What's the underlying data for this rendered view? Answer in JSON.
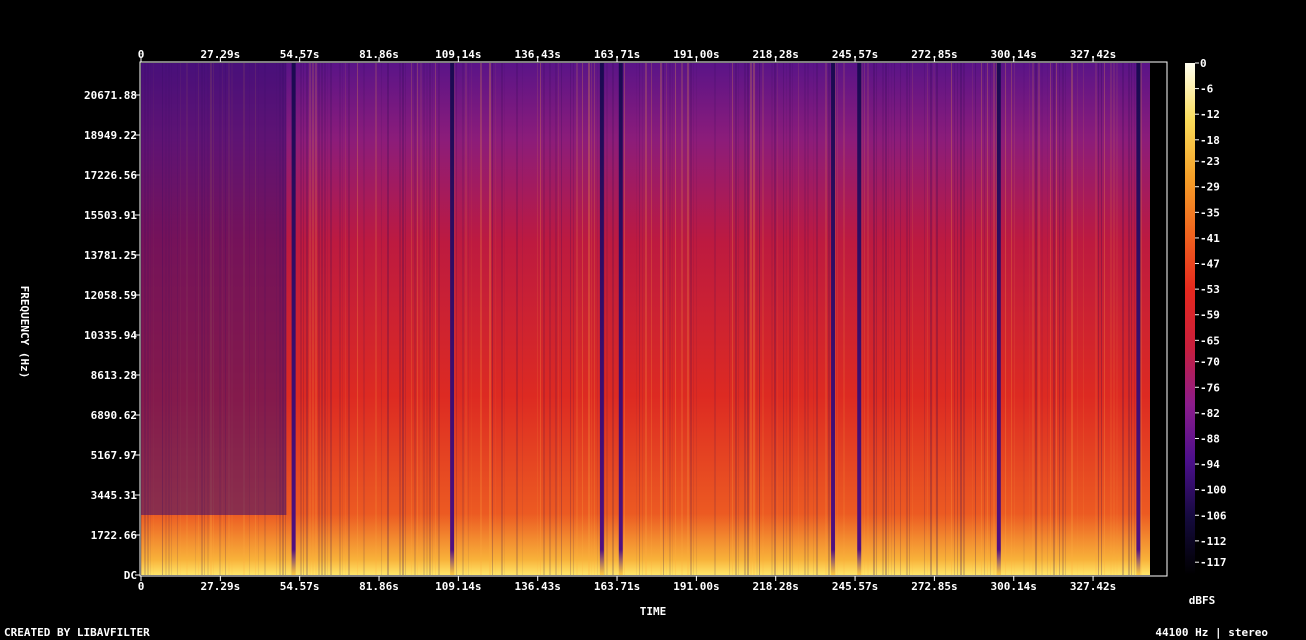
{
  "chart_data": {
    "type": "heatmap",
    "subtype": "spectrogram",
    "xlabel": "TIME",
    "ylabel": "FREQUENCY (Hz)",
    "colorbar_label": "dBFS",
    "x_ticks": [
      "0",
      "27.29s",
      "54.57s",
      "81.86s",
      "109.14s",
      "136.43s",
      "163.71s",
      "191.00s",
      "218.28s",
      "245.57s",
      "272.85s",
      "300.14s",
      "327.42s"
    ],
    "x_tick_values": [
      0,
      27.29,
      54.57,
      81.86,
      109.14,
      136.43,
      163.71,
      191.0,
      218.28,
      245.57,
      272.85,
      300.14,
      327.42
    ],
    "xlim": [
      0,
      347
    ],
    "y_ticks": [
      "DC",
      "1722.66",
      "3445.31",
      "5167.97",
      "6890.62",
      "8613.28",
      "10335.94",
      "12058.59",
      "13781.25",
      "15503.91",
      "17226.56",
      "18949.22",
      "20671.88"
    ],
    "y_tick_values": [
      0,
      1722.66,
      3445.31,
      5167.97,
      6890.62,
      8613.28,
      10335.94,
      12058.59,
      13781.25,
      15503.91,
      17226.56,
      18949.22,
      20671.88
    ],
    "ylim": [
      0,
      22050
    ],
    "colorbar_ticks": [
      "0",
      "-6",
      "-12",
      "-18",
      "-23",
      "-29",
      "-35",
      "-41",
      "-47",
      "-53",
      "-59",
      "-65",
      "-70",
      "-76",
      "-82",
      "-88",
      "-94",
      "-100",
      "-106",
      "-112",
      "-117"
    ],
    "colorbar_values": [
      0,
      -6,
      -12,
      -18,
      -23,
      -29,
      -35,
      -41,
      -47,
      -53,
      -59,
      -65,
      -70,
      -76,
      -82,
      -88,
      -94,
      -100,
      -106,
      -112,
      -117
    ],
    "zlim": [
      -120,
      0
    ],
    "colormap": [
      "#000000",
      "#140a3c",
      "#4b0f8c",
      "#8c1c8c",
      "#c81e3c",
      "#e6281e",
      "#f0641e",
      "#f5a028",
      "#fadc5a",
      "#fffff0"
    ],
    "quiet_gaps_s": [
      52.5,
      107.0,
      158.5,
      165.0,
      238.0,
      247.0,
      295.0,
      343.0
    ],
    "grid": false
  },
  "footer": {
    "created_by": "CREATED BY LIBAVFILTER",
    "stream_info": "44100 Hz | stereo"
  }
}
